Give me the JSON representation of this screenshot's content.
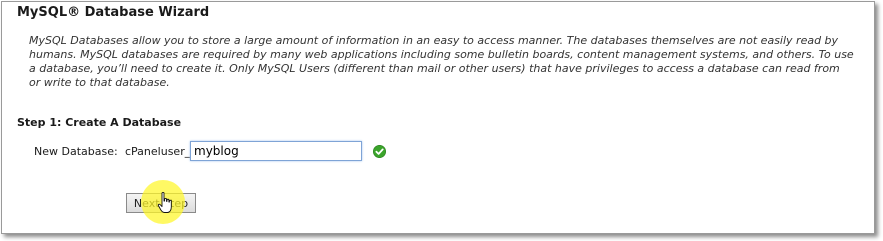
{
  "wizard": {
    "title": "MySQL® Database Wizard",
    "description": "MySQL Databases allow you to store a large amount of information in an easy to access manner. The databases themselves are not easily read by humans. MySQL databases are required by many web applications including some bulletin boards, content management systems, and others. To use a database, you’ll need to create it. Only MySQL Users (different than mail or other users) that have privileges to access a database can read from or write to that database."
  },
  "step": {
    "heading": "Step 1: Create A Database",
    "field_label": "New Database:",
    "prefix": "cPaneluser_",
    "input_value": "myblog",
    "valid_icon": "check-circle-icon",
    "next_label": "Next Step"
  },
  "cursor": {
    "icon": "hand-pointer-icon",
    "highlight_color": "#fff728"
  },
  "colors": {
    "valid_green": "#3aa42a",
    "input_focus_border": "#7fa4d6"
  }
}
